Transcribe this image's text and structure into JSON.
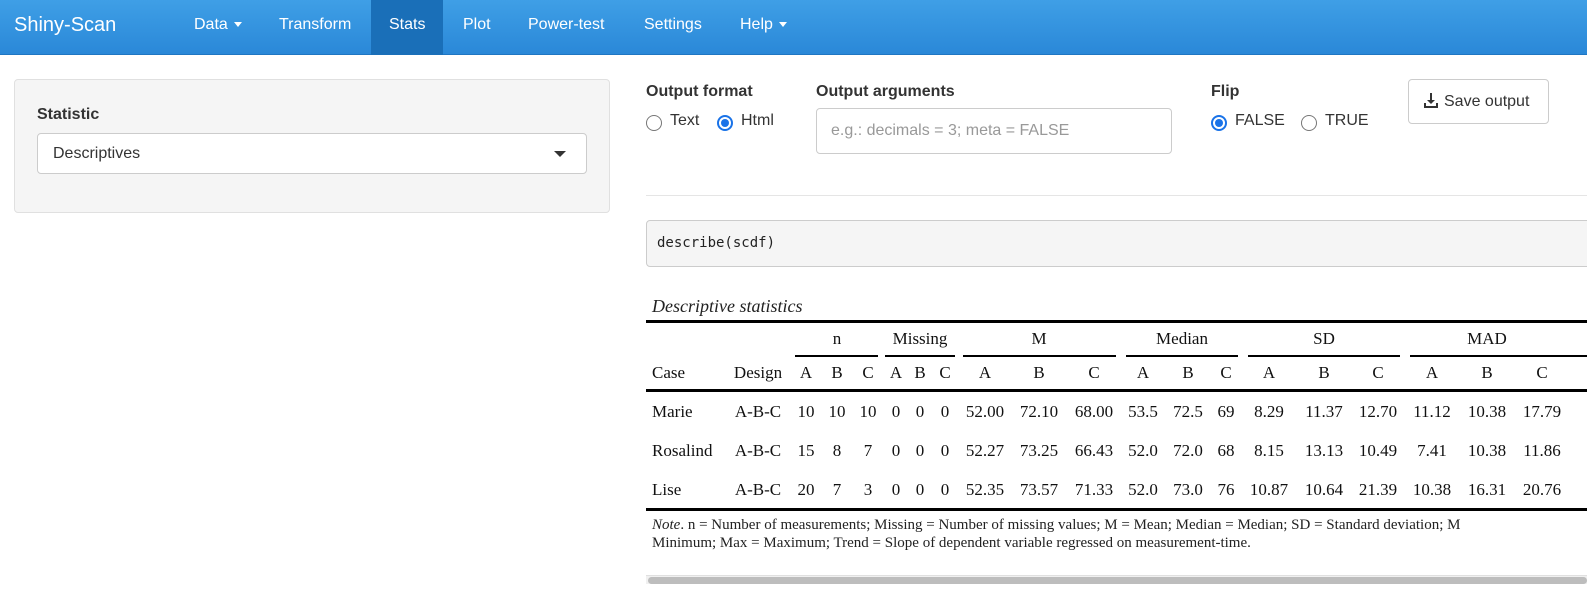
{
  "navbar": {
    "brand": "Shiny-Scan",
    "items": [
      {
        "label": "Data",
        "dropdown": true
      },
      {
        "label": "Transform"
      },
      {
        "label": "Stats",
        "active": true
      },
      {
        "label": "Plot"
      },
      {
        "label": "Power-test"
      },
      {
        "label": "Settings"
      },
      {
        "label": "Help",
        "dropdown": true
      }
    ]
  },
  "sidebar": {
    "statistic_label": "Statistic",
    "statistic_value": "Descriptives"
  },
  "controls": {
    "output_format": {
      "label": "Output format",
      "options": [
        {
          "label": "Text",
          "checked": false
        },
        {
          "label": "Html",
          "checked": true
        }
      ]
    },
    "output_arguments": {
      "label": "Output arguments",
      "placeholder": "e.g.: decimals = 3; meta = FALSE",
      "value": ""
    },
    "flip": {
      "label": "Flip",
      "options": [
        {
          "label": "FALSE",
          "checked": true
        },
        {
          "label": "TRUE",
          "checked": false
        }
      ]
    },
    "save_button": "Save output"
  },
  "code": "describe(scdf)",
  "table": {
    "caption": "Descriptive statistics",
    "groups": [
      "n",
      "Missing",
      "M",
      "Median",
      "SD",
      "MAD"
    ],
    "header": {
      "case": "Case",
      "design": "Design",
      "phases": [
        "A",
        "B",
        "C",
        "A",
        "B",
        "C",
        "A",
        "B",
        "C",
        "A",
        "B",
        "C",
        "A",
        "B",
        "C",
        "A",
        "B",
        "C"
      ]
    },
    "rows": [
      {
        "case": "Marie",
        "design": "A-B-C",
        "values": [
          "10",
          "10",
          "10",
          "0",
          "0",
          "0",
          "52.00",
          "72.10",
          "68.00",
          "53.5",
          "72.5",
          "69",
          "8.29",
          "11.37",
          "12.70",
          "11.12",
          "10.38",
          "17.79"
        ]
      },
      {
        "case": "Rosalind",
        "design": "A-B-C",
        "values": [
          "15",
          "8",
          "7",
          "0",
          "0",
          "0",
          "52.27",
          "73.25",
          "66.43",
          "52.0",
          "72.0",
          "68",
          "8.15",
          "13.13",
          "10.49",
          "7.41",
          "10.38",
          "11.86"
        ]
      },
      {
        "case": "Lise",
        "design": "A-B-C",
        "values": [
          "20",
          "7",
          "3",
          "0",
          "0",
          "0",
          "52.35",
          "73.57",
          "71.33",
          "52.0",
          "73.0",
          "76",
          "10.87",
          "10.64",
          "21.39",
          "10.38",
          "16.31",
          "20.76"
        ]
      }
    ],
    "note_label": "Note",
    "note_line1": ". n = Number of measurements; Missing = Number of missing values; M = Mean; Median = Median; SD = Standard deviation; M",
    "note_line2": "Minimum; Max = Maximum; Trend = Slope of dependent variable regressed on measurement-time."
  }
}
